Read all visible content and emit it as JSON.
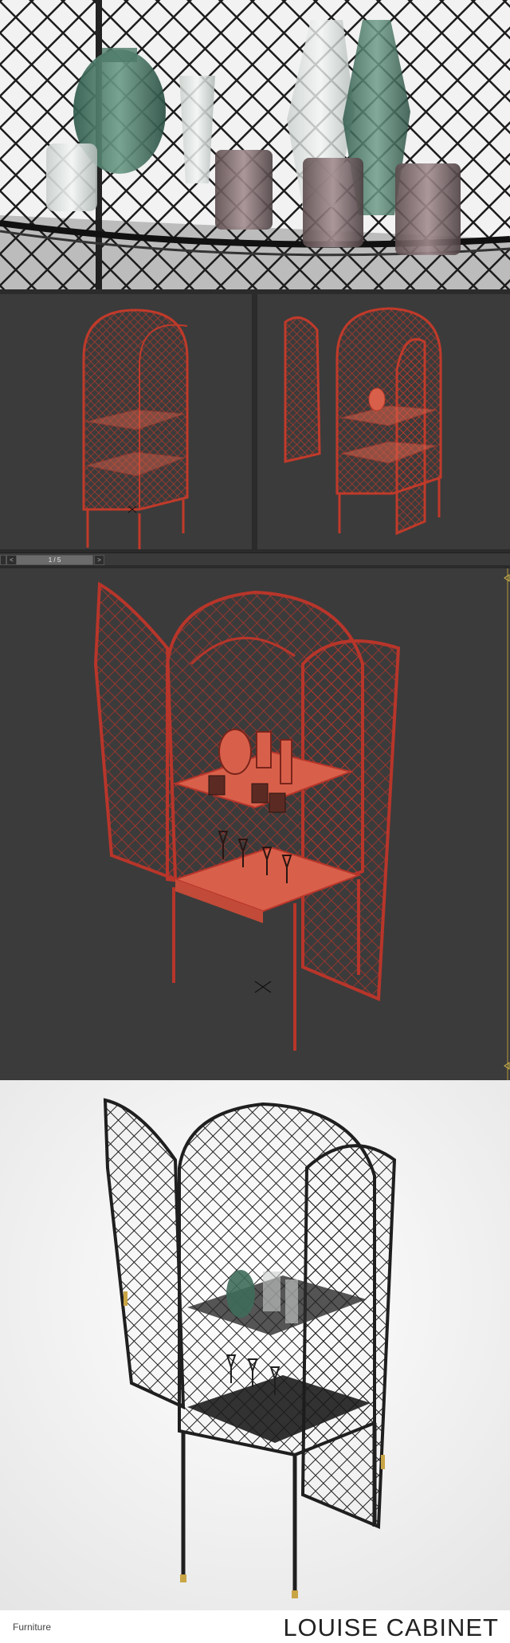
{
  "pager": {
    "prev": "<",
    "page": "1 / 5",
    "next": ">"
  },
  "footer": {
    "category": "Furniture",
    "title": "LOUISE CABINET"
  },
  "colors": {
    "wire_red": "#c03a2a",
    "wire_fill": "#d8604a",
    "viewport_bg": "#3b3b3b",
    "metal": "#1f1f1f",
    "vase_green": "#3f6b5a"
  },
  "icons": {
    "viewport_arrows": "triangle-marker-icon",
    "pivot": "cross-gizmo-icon"
  }
}
